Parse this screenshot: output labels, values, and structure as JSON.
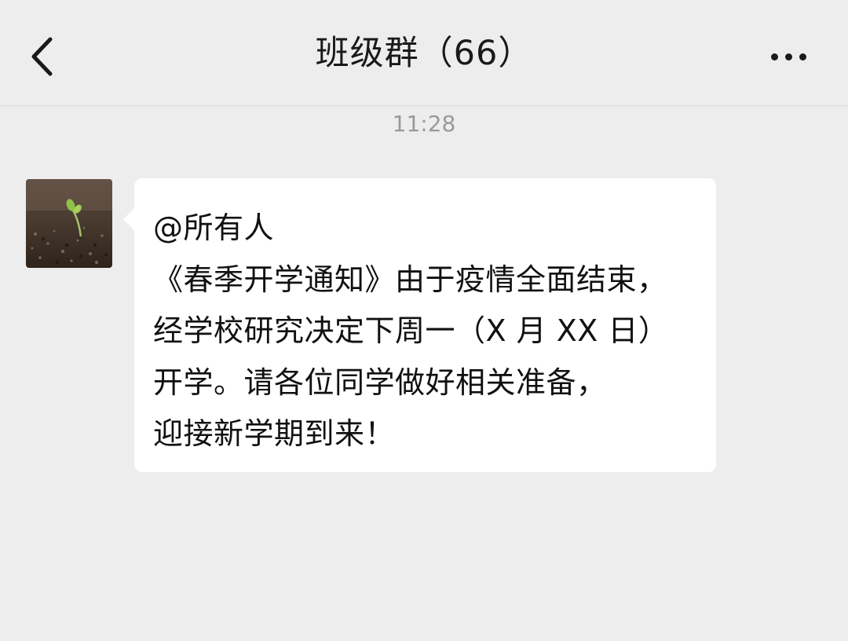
{
  "header": {
    "title": "班级群（66）",
    "back_icon": "chevron-left-icon",
    "more_icon": "more-horizontal-icon"
  },
  "chat": {
    "timestamp": "11:28",
    "messages": [
      {
        "avatar_icon": "sprout-avatar",
        "lines": [
          "@所有人",
          "《春季开学通知》由于疫情全面结束，",
          "经学校研究决定下周一（X 月 XX 日）",
          "开学。请各位同学做好相关准备，",
          "迎接新学期到来！"
        ]
      }
    ]
  },
  "colors": {
    "background": "#ededed",
    "bubble": "#ffffff",
    "text": "#111111",
    "timestamp": "#999999"
  }
}
